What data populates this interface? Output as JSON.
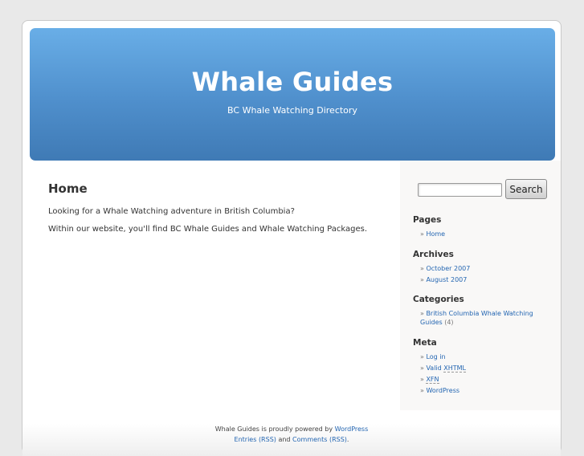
{
  "header": {
    "title": "Whale Guides",
    "description": "BC Whale Watching Directory"
  },
  "post": {
    "title": "Home",
    "paragraphs": [
      "Looking for a Whale Watching adventure in British Columbia?",
      "Within our website, you'll find BC Whale Guides and Whale Watching Packages."
    ]
  },
  "sidebar": {
    "search_button": "Search",
    "search_value": "",
    "pages": {
      "heading": "Pages",
      "items": [
        "Home"
      ]
    },
    "archives": {
      "heading": "Archives",
      "items": [
        "October 2007",
        "August 2007"
      ]
    },
    "categories": {
      "heading": "Categories",
      "items": [
        {
          "label": "British Columbia Whale Watching Guides",
          "count": "(4)"
        }
      ]
    },
    "meta": {
      "heading": "Meta",
      "log_in": "Log in",
      "valid_prefix": "Valid ",
      "valid_abbr": "XHTML",
      "xfn": "XFN",
      "wordpress": "WordPress"
    }
  },
  "footer": {
    "line1_prefix": "Whale Guides is proudly powered by ",
    "line1_link": "WordPress",
    "line2_entries": "Entries (RSS)",
    "line2_and": " and ",
    "line2_comments": "Comments (RSS)",
    "line2_suffix": "."
  },
  "colors": {
    "header_top": "#69aee7",
    "header_bottom": "#3f7ab5",
    "link": "#2466b2"
  }
}
